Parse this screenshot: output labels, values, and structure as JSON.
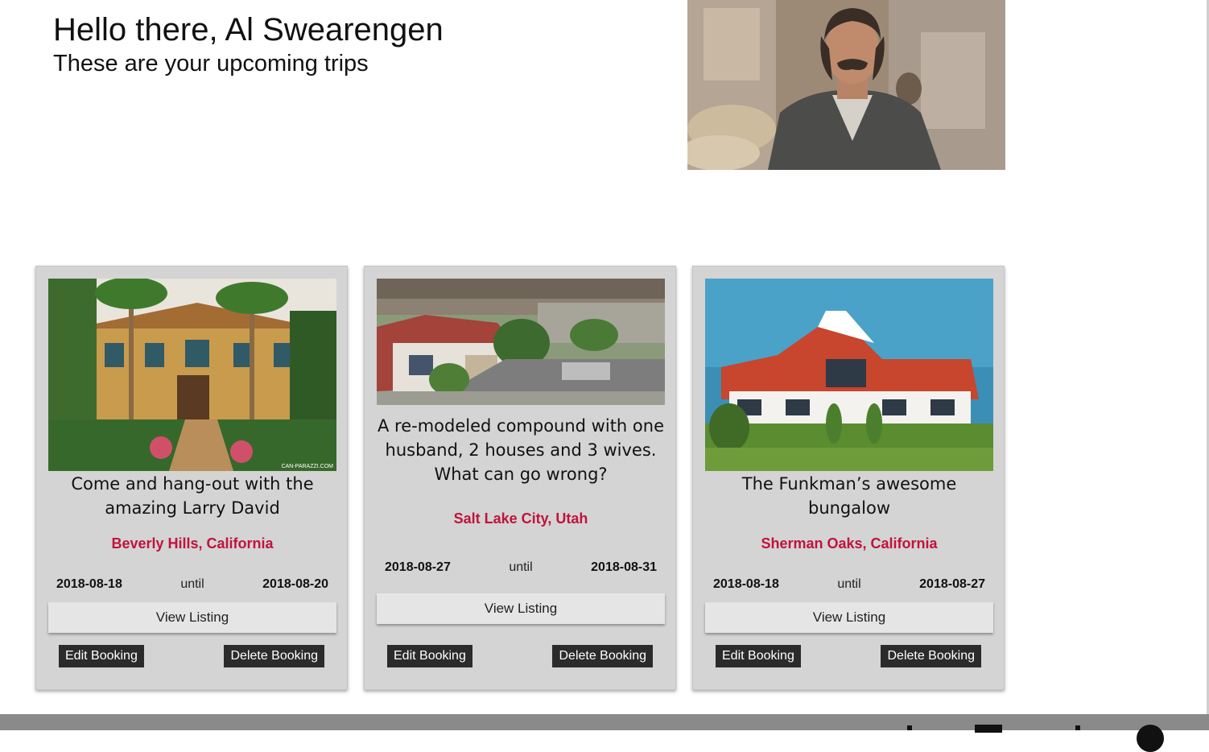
{
  "greeting": {
    "title": "Hello there, Al Swearengen",
    "subtitle": "These are your upcoming trips"
  },
  "trips": [
    {
      "title": "Come and hang-out with the amazing Larry David",
      "location": "Beverly Hills, California",
      "start": "2018-08-18",
      "until": "until",
      "end": "2018-08-20",
      "view_label": "View Listing",
      "edit_label": "Edit Booking",
      "delete_label": "Delete Booking",
      "photo_watermark": "CAN-PARAZZI.COM"
    },
    {
      "title": "A re-modeled compound with one husband, 2 houses and 3 wives. What can go wrong?",
      "location": "Salt Lake City, Utah",
      "start": "2018-08-27",
      "until": "until",
      "end": "2018-08-31",
      "view_label": "View Listing",
      "edit_label": "Edit Booking",
      "delete_label": "Delete Booking"
    },
    {
      "title": "The Funkman’s awesome bungalow",
      "location": "Sherman Oaks, California",
      "start": "2018-08-18",
      "until": "until",
      "end": "2018-08-27",
      "view_label": "View Listing",
      "edit_label": "Edit Booking",
      "delete_label": "Delete Booking"
    }
  ],
  "colors": {
    "location": "#c0133b",
    "card_bg": "#d4d4d4",
    "button_dark": "#2b2b2b",
    "footer": "#8a8a8a"
  }
}
